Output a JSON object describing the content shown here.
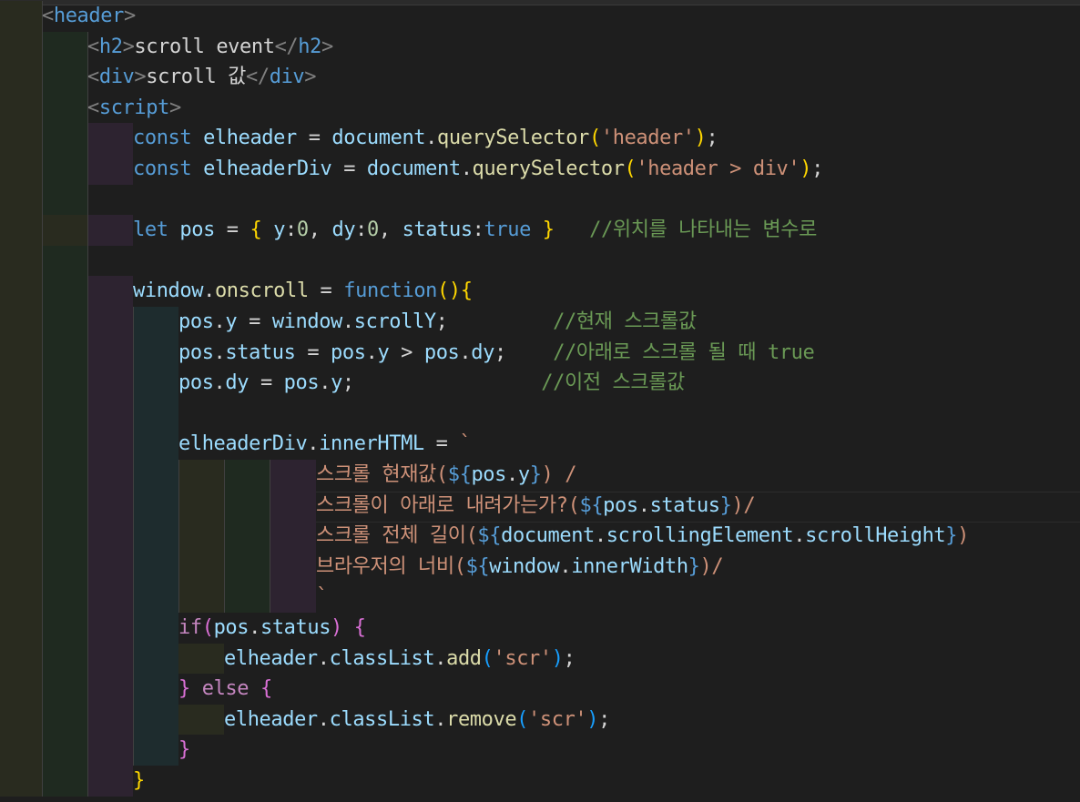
{
  "editor": {
    "language": "html",
    "lines": [
      [
        [
          "tg",
          "<"
        ],
        [
          "tn",
          "header"
        ],
        [
          "tg",
          ">"
        ]
      ],
      [
        [
          "tg",
          "<"
        ],
        [
          "tn",
          "h2"
        ],
        [
          "tg",
          ">"
        ],
        [
          "pl",
          "scroll event"
        ],
        [
          "tg",
          "</"
        ],
        [
          "tn",
          "h2"
        ],
        [
          "tg",
          ">"
        ]
      ],
      [
        [
          "tg",
          "<"
        ],
        [
          "tn",
          "div"
        ],
        [
          "tg",
          ">"
        ],
        [
          "pl",
          "scroll 값"
        ],
        [
          "tg",
          "</"
        ],
        [
          "tn",
          "div"
        ],
        [
          "tg",
          ">"
        ]
      ],
      [
        [
          "tg",
          "<"
        ],
        [
          "tn",
          "script"
        ],
        [
          "tg",
          ">"
        ]
      ],
      [
        [
          "kw",
          "const "
        ],
        [
          "vr",
          "elheader"
        ],
        [
          "pl",
          " = "
        ],
        [
          "vr",
          "document"
        ],
        [
          "pl",
          "."
        ],
        [
          "fn",
          "querySelector"
        ],
        [
          "b1",
          "("
        ],
        [
          "st",
          "'header'"
        ],
        [
          "b1",
          ")"
        ],
        [
          "pl",
          ";"
        ]
      ],
      [
        [
          "kw",
          "const "
        ],
        [
          "vr",
          "elheaderDiv"
        ],
        [
          "pl",
          " = "
        ],
        [
          "vr",
          "document"
        ],
        [
          "pl",
          "."
        ],
        [
          "fn",
          "querySelector"
        ],
        [
          "b1",
          "("
        ],
        [
          "st",
          "'header > div'"
        ],
        [
          "b1",
          ")"
        ],
        [
          "pl",
          ";"
        ]
      ],
      [],
      [
        [
          "kw",
          "let "
        ],
        [
          "vr",
          "pos"
        ],
        [
          "pl",
          " = "
        ],
        [
          "b1",
          "{ "
        ],
        [
          "vr",
          "y"
        ],
        [
          "pl",
          ":"
        ],
        [
          "nm",
          "0"
        ],
        [
          "pl",
          ", "
        ],
        [
          "vr",
          "dy"
        ],
        [
          "pl",
          ":"
        ],
        [
          "nm",
          "0"
        ],
        [
          "pl",
          ", "
        ],
        [
          "vr",
          "status"
        ],
        [
          "pl",
          ":"
        ],
        [
          "kw",
          "true"
        ],
        [
          "b1",
          " }"
        ],
        [
          "pl",
          "   "
        ],
        [
          "cm",
          "//위치를 나타내는 변수로"
        ]
      ],
      [],
      [
        [
          "vr",
          "window"
        ],
        [
          "pl",
          "."
        ],
        [
          "fn",
          "onscroll"
        ],
        [
          "pl",
          " = "
        ],
        [
          "kw",
          "function"
        ],
        [
          "b1",
          "()"
        ],
        [
          "b1",
          "{"
        ]
      ],
      [
        [
          "vr",
          "pos"
        ],
        [
          "pl",
          "."
        ],
        [
          "vr",
          "y"
        ],
        [
          "pl",
          " = "
        ],
        [
          "vr",
          "window"
        ],
        [
          "pl",
          "."
        ],
        [
          "vr",
          "scrollY"
        ],
        [
          "pl",
          ";         "
        ],
        [
          "cm",
          "//현재 스크롤값"
        ]
      ],
      [
        [
          "vr",
          "pos"
        ],
        [
          "pl",
          "."
        ],
        [
          "vr",
          "status"
        ],
        [
          "pl",
          " = "
        ],
        [
          "vr",
          "pos"
        ],
        [
          "pl",
          "."
        ],
        [
          "vr",
          "y"
        ],
        [
          "pl",
          " > "
        ],
        [
          "vr",
          "pos"
        ],
        [
          "pl",
          "."
        ],
        [
          "vr",
          "dy"
        ],
        [
          "pl",
          ";    "
        ],
        [
          "cm",
          "//아래로 스크롤 될 때 true"
        ]
      ],
      [
        [
          "vr",
          "pos"
        ],
        [
          "pl",
          "."
        ],
        [
          "vr",
          "dy"
        ],
        [
          "pl",
          " = "
        ],
        [
          "vr",
          "pos"
        ],
        [
          "pl",
          "."
        ],
        [
          "vr",
          "y"
        ],
        [
          "pl",
          ";                "
        ],
        [
          "cm",
          "//이전 스크롤값"
        ]
      ],
      [],
      [
        [
          "vr",
          "elheaderDiv"
        ],
        [
          "pl",
          "."
        ],
        [
          "vr",
          "innerHTML"
        ],
        [
          "pl",
          " = "
        ],
        [
          "st",
          "`"
        ]
      ],
      [
        [
          "st",
          "스크롤 현재값("
        ],
        [
          "tp",
          "${"
        ],
        [
          "vr",
          "pos"
        ],
        [
          "pl",
          "."
        ],
        [
          "vr",
          "y"
        ],
        [
          "tp",
          "}"
        ],
        [
          "st",
          ") /"
        ]
      ],
      [
        [
          "st",
          "스크롤이 아래로 내려가는가?("
        ],
        [
          "tp",
          "${"
        ],
        [
          "vr",
          "pos"
        ],
        [
          "pl",
          "."
        ],
        [
          "vr",
          "status"
        ],
        [
          "tp",
          "}"
        ],
        [
          "st",
          ")/"
        ]
      ],
      [
        [
          "st",
          "스크롤 전체 길이("
        ],
        [
          "tp",
          "${"
        ],
        [
          "vr",
          "document"
        ],
        [
          "pl",
          "."
        ],
        [
          "vr",
          "scrollingElement"
        ],
        [
          "pl",
          "."
        ],
        [
          "vr",
          "scrollHeight"
        ],
        [
          "tp",
          "}"
        ],
        [
          "st",
          ")"
        ]
      ],
      [
        [
          "st",
          "브라우저의 너비("
        ],
        [
          "tp",
          "${"
        ],
        [
          "vr",
          "window"
        ],
        [
          "pl",
          "."
        ],
        [
          "vr",
          "innerWidth"
        ],
        [
          "tp",
          "}"
        ],
        [
          "st",
          ")/"
        ]
      ],
      [
        [
          "st",
          "`"
        ]
      ],
      [
        [
          "cf",
          "if"
        ],
        [
          "b2",
          "("
        ],
        [
          "vr",
          "pos"
        ],
        [
          "pl",
          "."
        ],
        [
          "vr",
          "status"
        ],
        [
          "b2",
          ")"
        ],
        [
          "pl",
          " "
        ],
        [
          "b2",
          "{"
        ]
      ],
      [
        [
          "vr",
          "elheader"
        ],
        [
          "pl",
          "."
        ],
        [
          "vr",
          "classList"
        ],
        [
          "pl",
          "."
        ],
        [
          "fn",
          "add"
        ],
        [
          "b3",
          "("
        ],
        [
          "st",
          "'scr'"
        ],
        [
          "b3",
          ")"
        ],
        [
          "pl",
          ";"
        ]
      ],
      [
        [
          "b2",
          "}"
        ],
        [
          "pl",
          " "
        ],
        [
          "cf",
          "else"
        ],
        [
          "pl",
          " "
        ],
        [
          "b2",
          "{"
        ]
      ],
      [
        [
          "vr",
          "elheader"
        ],
        [
          "pl",
          "."
        ],
        [
          "vr",
          "classList"
        ],
        [
          "pl",
          "."
        ],
        [
          "fn",
          "remove"
        ],
        [
          "b3",
          "("
        ],
        [
          "st",
          "'scr'"
        ],
        [
          "b3",
          ")"
        ],
        [
          "pl",
          ";"
        ]
      ],
      [
        [
          "b2",
          "}"
        ]
      ],
      [
        [
          "b1",
          "}"
        ]
      ]
    ]
  }
}
